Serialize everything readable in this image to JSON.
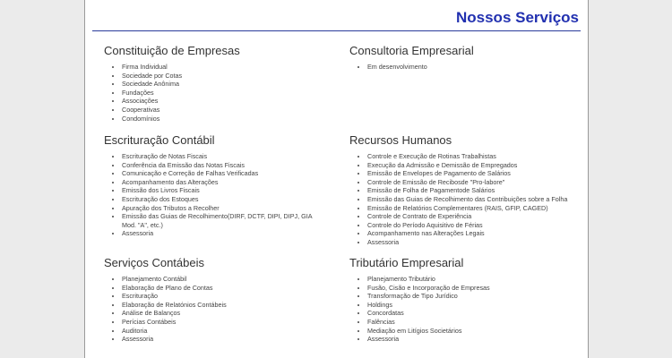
{
  "header": {
    "title": "Nossos Serviços"
  },
  "sections": [
    {
      "title": "Constituição de Empresas",
      "items": [
        "Firma Individual",
        "Sociedade por Cotas",
        "Sociedade Anônima",
        "Fundações",
        "Associações",
        "Cooperativas",
        "Condomínios"
      ]
    },
    {
      "title": "Consultoria Empresarial",
      "items": [
        "Em desenvolvimento"
      ]
    },
    {
      "title": "Escrituração Contábil",
      "items": [
        "Escrituração de Notas Fiscais",
        "Conferência da Emissão das Notas Fiscais",
        "Comunicação e Correção de Falhas Verificadas",
        "Acompanhamento das Alterações",
        "Emissão dos Livros Fiscais",
        "Escrituração dos Estoques",
        "Apuração dos Tributos a Recolher",
        "Emissão das Guias de Recolhimento(DIRF, DCTF, DIPI, DIPJ, GIA Mod. \"A\", etc.)",
        "Assessoria"
      ]
    },
    {
      "title": "Recursos Humanos",
      "items": [
        "Controle e Execução de Rotinas Trabalhistas",
        "Execução da Admissão e Demissão de Empregados",
        "Emissão de Envelopes de Pagamento de Salários",
        "Controle de Emissão de Recibosde \"Pro-labore\"",
        "Emissão de Folha de Pagamentode Salários",
        "Emissão das Guias de Recolhimento das Contribuições sobre a Folha",
        "Emissão de Relatórios Complementares (RAIS, GFIP, CAGED)",
        "Controle de Contrato de Experiência",
        "Controle do Período Aquisitivo de Férias",
        "Acompanhamento nas Alterações Legais",
        "Assessoria"
      ]
    },
    {
      "title": "Serviços Contábeis",
      "items": [
        "Planejamento Contábil",
        "Elaboração de Plano de Contas",
        "Escrituração",
        "Elaboração de Relatónios Contábeis",
        "Análise de Balanços",
        "Perícias Contábeis",
        "Auditoria",
        "Assessoria"
      ]
    },
    {
      "title": "Tributário Empresarial",
      "items": [
        "Planejamento Tributário",
        "Fusão, Cisão e Incorporação de Empresas",
        "Transformação de Tipo Jurídico",
        "Holdings",
        "Concordatas",
        "Falências",
        "Mediação em Litígios Societários",
        "Assessoria"
      ]
    }
  ]
}
